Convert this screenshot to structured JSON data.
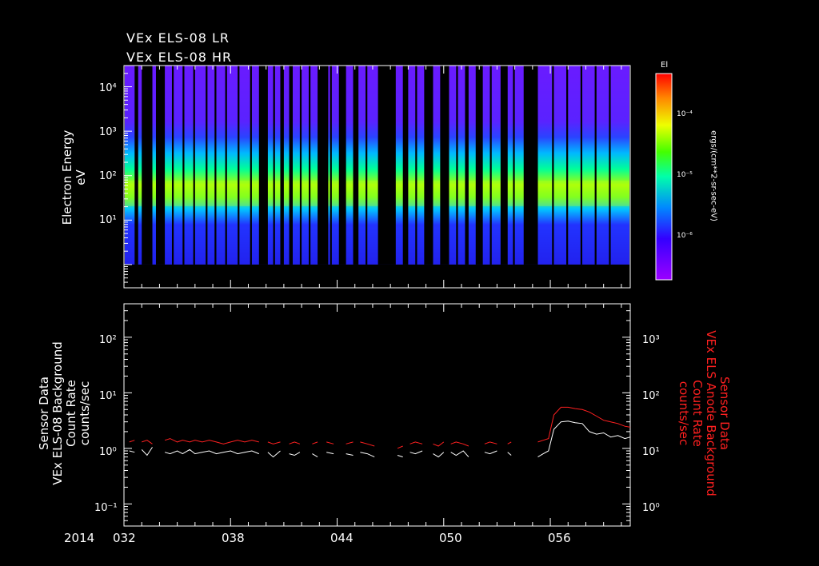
{
  "titles": [
    "VEx ELS-08 LR",
    "VEx ELS-08 HR"
  ],
  "colors": {
    "background": "#000000",
    "axes": "#ffffff",
    "right_axis": "#ff2020",
    "series_white": "#ffffff",
    "series_red": "#ff2020"
  },
  "colorbar": {
    "label_top": "El",
    "unit_label": "ergs/(cm**2-sr-sec-eV)",
    "ticks": [
      "10⁻⁴",
      "10⁻⁵",
      "10⁻⁶"
    ],
    "colormap": "rainbow (purple → blue → cyan → green → yellow → red)"
  },
  "chart_data": [
    {
      "type": "heatmap",
      "title": "",
      "ylabel": [
        "Electron Energy",
        "eV"
      ],
      "yscale": "log",
      "ylim": [
        0.3,
        30000
      ],
      "y_ticks": [
        "10¹",
        "10²",
        "10³",
        "10⁴"
      ],
      "x_range_doy": [
        32,
        60.5
      ],
      "gap_intervals_doy": [
        [
          32.6,
          32.8
        ],
        [
          33.0,
          33.6
        ],
        [
          33.8,
          34.3
        ],
        [
          34.7,
          34.8
        ],
        [
          35.3,
          35.4
        ],
        [
          35.9,
          36.0
        ],
        [
          36.6,
          36.7
        ],
        [
          37.1,
          37.2
        ],
        [
          37.7,
          37.8
        ],
        [
          38.4,
          38.5
        ],
        [
          39.1,
          39.2
        ],
        [
          39.6,
          40.1
        ],
        [
          40.4,
          40.5
        ],
        [
          40.8,
          41.0
        ],
        [
          41.3,
          41.5
        ],
        [
          41.9,
          42.0
        ],
        [
          42.4,
          42.5
        ],
        [
          42.9,
          43.5
        ],
        [
          43.6,
          43.7
        ],
        [
          44.1,
          44.5
        ],
        [
          44.9,
          45.2
        ],
        [
          45.6,
          45.7
        ],
        [
          46.3,
          47.3
        ],
        [
          47.7,
          48.0
        ],
        [
          48.4,
          48.5
        ],
        [
          48.9,
          49.4
        ],
        [
          49.8,
          50.3
        ],
        [
          50.7,
          50.8
        ],
        [
          51.2,
          51.4
        ],
        [
          51.8,
          52.2
        ],
        [
          52.6,
          52.7
        ],
        [
          53.2,
          53.6
        ],
        [
          53.9,
          54.0
        ],
        [
          54.5,
          55.3
        ],
        [
          56.1,
          56.2
        ],
        [
          56.9,
          57.0
        ],
        [
          57.7,
          57.8
        ],
        [
          58.5,
          58.6
        ],
        [
          59.3,
          59.4
        ]
      ],
      "peak_energy_eV": 40,
      "note_shape": "flux peaks near 20–100 eV in each data interval"
    },
    {
      "type": "line",
      "title": "",
      "ylabel_left": [
        "Sensor Data",
        "VEx ELS-08 Background",
        "Count Rate",
        "counts/sec"
      ],
      "ylabel_right": [
        "Sensor Data",
        "VEx ELS Anode Background",
        "Count Rate",
        "counts/sec"
      ],
      "yscale": "log",
      "ylim_left": [
        0.04,
        400
      ],
      "ylim_right": [
        0.4,
        4000
      ],
      "y_ticks_left": [
        "10⁻¹",
        "10⁰",
        "10¹",
        "10²"
      ],
      "y_ticks_right": [
        "10⁰",
        "10¹",
        "10²",
        "10³"
      ],
      "x_year": "2014",
      "x_ticks": [
        "032",
        "038",
        "044",
        "050",
        "056"
      ],
      "x_tick_values": [
        32,
        38,
        44,
        50,
        56
      ],
      "series": [
        {
          "color": "#ffffff",
          "axis": "left",
          "segments": [
            {
              "x": [
                32.3,
                32.6
              ],
              "y": [
                0.9,
                0.85
              ]
            },
            {
              "x": [
                33.0,
                33.3,
                33.6
              ],
              "y": [
                0.95,
                0.75,
                1.05
              ]
            },
            {
              "x": [
                34.3,
                34.6,
                35.0,
                35.3,
                35.7,
                36.0,
                36.4,
                36.8,
                37.2,
                37.6,
                38.0,
                38.4,
                38.8,
                39.2,
                39.6
              ],
              "y": [
                0.85,
                0.8,
                0.9,
                0.8,
                0.95,
                0.8,
                0.85,
                0.9,
                0.8,
                0.85,
                0.9,
                0.8,
                0.85,
                0.9,
                0.8
              ]
            },
            {
              "x": [
                40.1,
                40.4,
                40.8
              ],
              "y": [
                0.85,
                0.7,
                0.9
              ]
            },
            {
              "x": [
                41.3,
                41.6,
                41.9
              ],
              "y": [
                0.8,
                0.75,
                0.85
              ]
            },
            {
              "x": [
                42.6,
                42.9
              ],
              "y": [
                0.8,
                0.7
              ]
            },
            {
              "x": [
                43.4,
                43.8
              ],
              "y": [
                0.85,
                0.8
              ]
            },
            {
              "x": [
                44.5,
                44.9
              ],
              "y": [
                0.8,
                0.75
              ]
            },
            {
              "x": [
                45.3,
                45.7,
                46.1
              ],
              "y": [
                0.85,
                0.8,
                0.7
              ]
            },
            {
              "x": [
                47.4,
                47.7
              ],
              "y": [
                0.75,
                0.7
              ]
            },
            {
              "x": [
                48.1,
                48.4,
                48.8
              ],
              "y": [
                0.85,
                0.8,
                0.9
              ]
            },
            {
              "x": [
                49.4,
                49.7,
                50.0
              ],
              "y": [
                0.8,
                0.7,
                0.85
              ]
            },
            {
              "x": [
                50.4,
                50.7,
                51.1,
                51.4
              ],
              "y": [
                0.85,
                0.75,
                0.9,
                0.7
              ]
            },
            {
              "x": [
                52.3,
                52.6,
                53.0
              ],
              "y": [
                0.85,
                0.8,
                0.9
              ]
            },
            {
              "x": [
                53.6,
                53.8
              ],
              "y": [
                0.85,
                0.75
              ]
            },
            {
              "x": [
                55.3,
                55.6,
                55.9,
                56.2,
                56.6,
                57.0,
                57.4,
                57.8,
                58.2,
                58.6,
                59.0,
                59.4,
                59.8,
                60.2,
                60.5
              ],
              "y": [
                0.7,
                0.8,
                0.9,
                2.2,
                3.0,
                3.1,
                2.9,
                2.8,
                2.0,
                1.8,
                1.9,
                1.6,
                1.7,
                1.5,
                1.6
              ]
            }
          ]
        },
        {
          "color": "#ff2020",
          "axis": "right",
          "segments": [
            {
              "x": [
                32.3,
                32.6
              ],
              "y": [
                13,
                14
              ]
            },
            {
              "x": [
                33.0,
                33.3,
                33.6
              ],
              "y": [
                13,
                14,
                12
              ]
            },
            {
              "x": [
                34.3,
                34.6,
                35.0,
                35.3,
                35.7,
                36.0,
                36.4,
                36.8,
                37.2,
                37.6,
                38.0,
                38.4,
                38.8,
                39.2,
                39.6
              ],
              "y": [
                14,
                15,
                13,
                14,
                13,
                14,
                13,
                14,
                13,
                12,
                13,
                14,
                13,
                14,
                13
              ]
            },
            {
              "x": [
                40.1,
                40.4,
                40.8
              ],
              "y": [
                13,
                12,
                13
              ]
            },
            {
              "x": [
                41.3,
                41.6,
                41.9
              ],
              "y": [
                12,
                13,
                12
              ]
            },
            {
              "x": [
                42.6,
                42.9
              ],
              "y": [
                12,
                13
              ]
            },
            {
              "x": [
                43.4,
                43.8
              ],
              "y": [
                13,
                12
              ]
            },
            {
              "x": [
                44.5,
                44.9
              ],
              "y": [
                12,
                13
              ]
            },
            {
              "x": [
                45.3,
                45.7,
                46.1
              ],
              "y": [
                13,
                12,
                11
              ]
            },
            {
              "x": [
                47.4,
                47.7
              ],
              "y": [
                10,
                11
              ]
            },
            {
              "x": [
                48.1,
                48.4,
                48.8
              ],
              "y": [
                12,
                13,
                12
              ]
            },
            {
              "x": [
                49.4,
                49.7,
                50.0
              ],
              "y": [
                12,
                11,
                13
              ]
            },
            {
              "x": [
                50.4,
                50.7,
                51.1,
                51.4
              ],
              "y": [
                12,
                13,
                12,
                11
              ]
            },
            {
              "x": [
                52.3,
                52.6,
                53.0
              ],
              "y": [
                12,
                13,
                12
              ]
            },
            {
              "x": [
                53.6,
                53.8
              ],
              "y": [
                12,
                13
              ]
            },
            {
              "x": [
                55.3,
                55.6,
                55.9,
                56.2,
                56.6,
                57.0,
                57.4,
                57.8,
                58.2,
                58.6,
                59.0,
                59.4,
                59.8,
                60.2,
                60.5
              ],
              "y": [
                13,
                14,
                15,
                40,
                55,
                55,
                52,
                50,
                45,
                38,
                32,
                30,
                28,
                25,
                24
              ]
            }
          ]
        }
      ]
    }
  ]
}
